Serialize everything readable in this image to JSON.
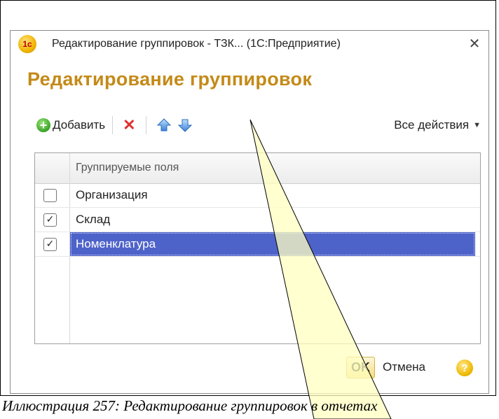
{
  "window": {
    "title": "Редактирование группировок - ТЗК... (1С:Предприятие)",
    "app_icon_text": "1с",
    "close_glyph": "✕",
    "heading": "Редактирование группировок"
  },
  "toolbar": {
    "add_label": "Добавить",
    "all_actions_label": "Все действия",
    "icons": [
      "add-icon",
      "delete-icon",
      "move-up-icon",
      "move-down-icon"
    ]
  },
  "grid": {
    "column_header": "Группируемые поля",
    "rows": [
      {
        "label": "Организация",
        "checked": false,
        "selected": false
      },
      {
        "label": "Склад",
        "checked": true,
        "selected": false
      },
      {
        "label": "Номенклатура",
        "checked": true,
        "selected": true
      }
    ]
  },
  "footer": {
    "ok_label": "OK",
    "cancel_label": "Отмена",
    "help_glyph": "?"
  },
  "caption": {
    "text": "Иллюстрация 257: Редактирование группировок в отчетах"
  },
  "colors": {
    "heading": "#c48a18",
    "selection": "#4e63c9",
    "callout_fill": "#ffffc0"
  }
}
